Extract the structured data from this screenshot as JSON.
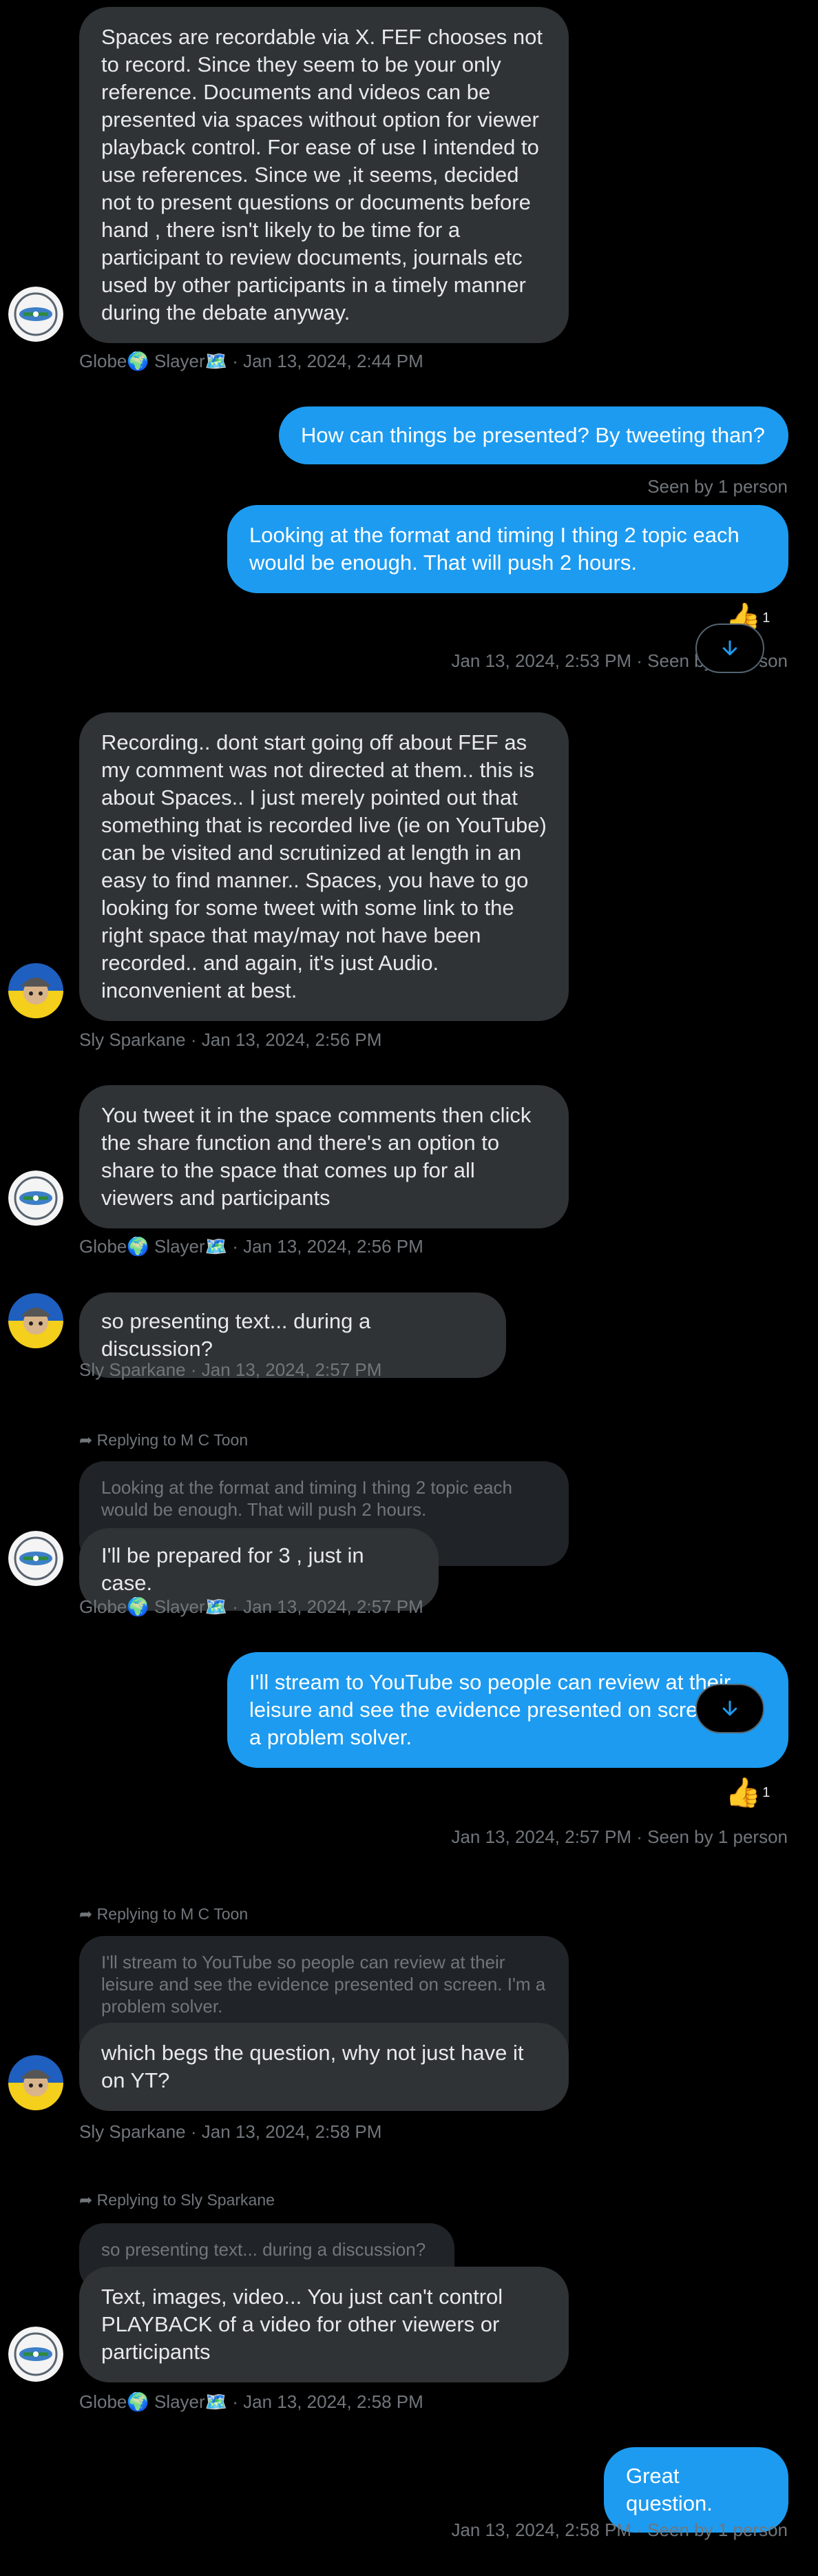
{
  "messages": {
    "m1": {
      "text": "Spaces are recordable via X. FEF chooses not to record. Since they seem to be your only reference. Documents and videos can be presented via spaces without option for viewer playback control. For ease of use I intended to use references. Since we ,it seems, decided not to present questions or documents before hand , there isn't likely to be time for a participant to review documents, journals etc used by other participants in a timely manner during the debate anyway.",
      "meta": "Globe🌍 Slayer🗺️ · Jan 13, 2024, 2:44 PM"
    },
    "m2": {
      "text": "How can things be presented?  By tweeting than?",
      "meta": "Seen by 1 person"
    },
    "m3": {
      "text": "Looking at the format and timing I thing 2 topic each would be enough. That will push 2 hours.",
      "reaction_count": "1",
      "meta": "Jan 13, 2024, 2:53 PM · Seen by 1 person"
    },
    "m4": {
      "text": "Recording.. dont start going off about FEF as my comment was not directed at them.. this is about Spaces.. I just merely pointed out that something that is recorded live (ie on YouTube) can be visited and scrutinized at length in an easy to find manner.. Spaces, you have to go looking for some tweet with some link to the right space that may/may not have been recorded.. and again, it's just Audio. inconvenient at best.",
      "meta": "Sly Sparkane · Jan 13, 2024, 2:56 PM"
    },
    "m5": {
      "text": "You tweet it in the space comments then click the share function and there's an option to share to the space that comes up for all viewers and participants",
      "meta": "Globe🌍 Slayer🗺️ · Jan 13, 2024, 2:56 PM"
    },
    "m6": {
      "text": "so presenting text... during a discussion?",
      "meta": "Sly Sparkane · Jan 13, 2024, 2:57 PM"
    },
    "m7": {
      "reply_label": "Replying to M C Toon",
      "quote": "Looking at the format and timing I thing 2 topic each would be enough. That will push 2 hours.",
      "text": "I'll be prepared for 3 , just in case.",
      "meta": "Globe🌍 Slayer🗺️ · Jan 13, 2024, 2:57 PM"
    },
    "m8": {
      "text": "I'll stream to YouTube so people can review at their leisure and see the evidence presented on screen. I'm a problem solver.",
      "reaction_count": "1",
      "meta": "Jan 13, 2024, 2:57 PM · Seen by 1 person"
    },
    "m9": {
      "reply_label": "Replying to M C Toon",
      "quote": "I'll stream to YouTube so people can review at their leisure and see the evidence presented on screen. I'm a problem solver.",
      "text": "which begs the question, why not just have it on YT?",
      "meta": "Sly Sparkane · Jan 13, 2024, 2:58 PM"
    },
    "m10": {
      "reply_label": "Replying to Sly Sparkane",
      "quote": "so presenting text... during a discussion?",
      "text": "Text, images, video... You just can't control PLAYBACK of a video for other viewers or participants",
      "meta": "Globe🌍 Slayer🗺️ · Jan 13, 2024, 2:58 PM"
    },
    "m11": {
      "text": "Great question.",
      "meta": "Jan 13, 2024, 2:58 PM · Seen by 1 person"
    }
  },
  "icons": {
    "reaction": "thumbs-up",
    "reply": "reply-arrow",
    "scroll": "arrow-down",
    "avatar_globe": "globe-map-avatar",
    "avatar_sly": "sly-sparkane-avatar"
  },
  "colors": {
    "background": "#000000",
    "incoming_bubble": "#2f3336",
    "outgoing_bubble": "#1d9bf0",
    "quote_bubble": "#202327",
    "meta_text": "#71767b"
  }
}
